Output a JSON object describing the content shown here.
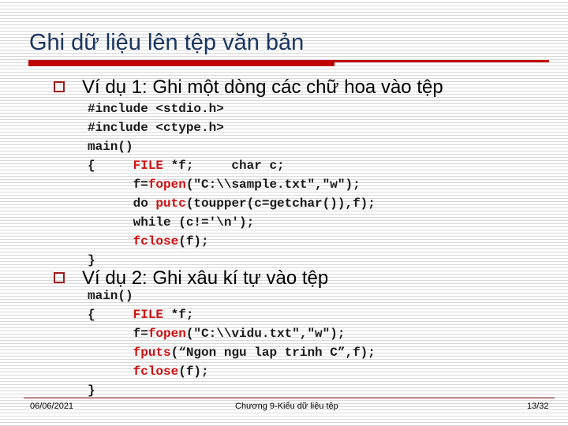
{
  "slide": {
    "title": "Ghi dữ liệu lên tệp văn bản",
    "colors": {
      "title": "#1a3560",
      "accent_bar": "#c00000",
      "bullet_border": "#a01c1c",
      "keyword": "#cc1111",
      "footer_line": "#8b1a1a"
    }
  },
  "examples": [
    {
      "bullet_icon": "hollow-square-bullet",
      "heading": "Ví dụ 1: Ghi một dòng các chữ hoa vào tệp",
      "code_lines": [
        [
          {
            "t": "#include <stdio.h>"
          }
        ],
        [
          {
            "t": "#include <ctype.h>"
          }
        ],
        [
          {
            "t": "main()"
          }
        ],
        [
          {
            "t": "{     "
          },
          {
            "t": "FILE",
            "kw": true
          },
          {
            "t": " *f;     char c;"
          }
        ],
        [
          {
            "t": "      f="
          },
          {
            "t": "fopen",
            "kw": true
          },
          {
            "t": "(\"C:\\\\sample.txt\",\"w\");"
          }
        ],
        [
          {
            "t": "      do "
          },
          {
            "t": "putc",
            "kw": true
          },
          {
            "t": "(toupper(c=getchar()),f);"
          }
        ],
        [
          {
            "t": "      while (c!='\\n');"
          }
        ],
        [
          {
            "t": "      "
          },
          {
            "t": "fclose",
            "kw": true
          },
          {
            "t": "(f);"
          }
        ],
        [
          {
            "t": "}"
          }
        ]
      ]
    },
    {
      "bullet_icon": "hollow-square-bullet",
      "heading": "Ví dụ 2: Ghi xâu kí tự vào tệp",
      "code_lines": [
        [
          {
            "t": "main()"
          }
        ],
        [
          {
            "t": "{     "
          },
          {
            "t": "FILE",
            "kw": true
          },
          {
            "t": " *f;"
          }
        ],
        [
          {
            "t": "      f="
          },
          {
            "t": "fopen",
            "kw": true
          },
          {
            "t": "(\"C:\\\\vidu.txt\",\"w\");"
          }
        ],
        [
          {
            "t": "      "
          },
          {
            "t": "fputs",
            "kw": true
          },
          {
            "t": "(“Ngon ngu lap trinh C”,f);"
          }
        ],
        [
          {
            "t": "      "
          },
          {
            "t": "fclose",
            "kw": true
          },
          {
            "t": "(f);"
          }
        ],
        [
          {
            "t": "}"
          }
        ]
      ]
    }
  ],
  "footer": {
    "date": "06/06/2021",
    "center": "Chương 9-Kiểu dữ liệu tệp",
    "page": "13/32"
  }
}
